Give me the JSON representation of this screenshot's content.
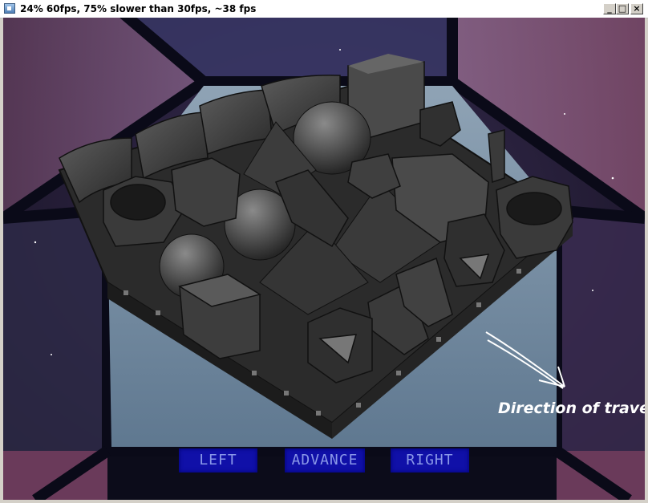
{
  "window": {
    "title": "24% 60fps, 75% slower than 30fps, ~38 fps",
    "controls": {
      "minimize": "_",
      "maximize": "□",
      "close": "×"
    }
  },
  "hud": {
    "buttons": [
      {
        "label": "LEFT"
      },
      {
        "label": "ADVANCE"
      },
      {
        "label": "RIGHT"
      }
    ],
    "button_color": "#1010a8",
    "button_text_color": "#8a98e8"
  },
  "annotation": {
    "text": "Direction of travel"
  }
}
